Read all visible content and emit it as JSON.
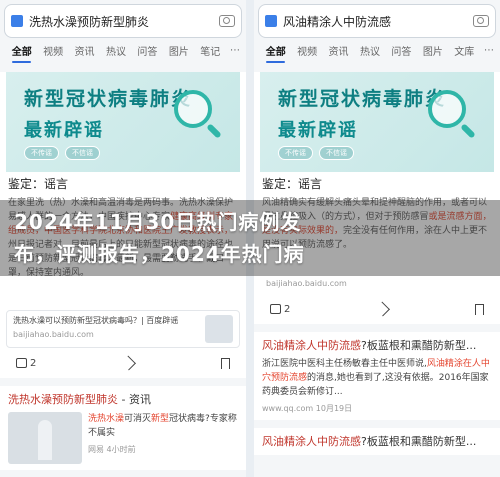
{
  "left": {
    "query": "洗热水澡预防新型肺炎",
    "tabs": [
      "全部",
      "视频",
      "资讯",
      "热议",
      "问答",
      "图片",
      "笔记"
    ],
    "banner_line1": "新型冠状病毒肺炎",
    "banner_line2": "最新辟谣",
    "banner_pill1": "不传谣",
    "banner_pill2": "不信谣",
    "verdict": "鉴定：谣言",
    "snippet_a": "在家里洗（热）水澡和高温消毒是两码事。洗热水澡保护易感人群的一个方法，中国疾控中心专家",
    "snippet_b": "健康高级别专家组成员，中国医学科学院北京协和医院王广发教授表示，",
    "snippet_c": "州日报记者对，目前最后上的只能新型冠状病毒的途径也是日前预防新型冠状病毒，最新，最需要",
    "snippet_d": "勤洗手、戴口罩，保持室内通风。",
    "source_title": "洗热水澡可以预防新型冠状病毒吗？| 百度辟谣",
    "source_site": "baijiahao.baidu.com",
    "likes": "2",
    "result_title_a": "洗热水澡预防新型肺炎",
    "result_title_b": " - 资讯",
    "result_text_a": "洗热水澡",
    "result_text_b": "可消灭",
    "result_text_c": "新型",
    "result_text_d": "冠状病毒?专家称不属实",
    "result_meta": "网易   4小时前"
  },
  "right": {
    "query": "风油精涂人中防流感",
    "tabs": [
      "全部",
      "视频",
      "资讯",
      "热议",
      "问答",
      "图片",
      "文库"
    ],
    "banner_line1": "新型冠状病毒肺炎",
    "banner_line2": "最新辟谣",
    "banner_pill1": "不传谣",
    "banner_pill2": "不信谣",
    "verdict": "鉴定：谣言",
    "snippet_a": "风油精确实有缓解头痛头晕和提神醒脑的作用，或者可以通过鼻腔吸入（的方式），但对于预防感冒",
    "snippet_b": "或是流感方面，是没有实际效果的，",
    "snippet_c": "完全没有任何作用，涂在人中上更不用说可以预防流感了。",
    "snippet_d": "",
    "source_title": "",
    "source_site": "baijiahao.baidu.com",
    "likes": "2",
    "result_title_a": "风油精涂人中防流感",
    "result_title_b": "?板蓝根和熏醋防新型...",
    "result_text_a": "浙江医院中医科主任杨敏春主任中医师说,",
    "result_text_b": "风油精涂在人中穴预防流感",
    "result_text_c": "的消息,她也看到了,这没有依据。2016年国家药典委员会新修订...",
    "result_meta": "www.qq.com   10月19日",
    "result2_title_a": "风油精涂人中防流感",
    "result2_title_b": "?板蓝根和熏醋防新型..."
  },
  "overlay": {
    "line1": "2024年11月30日热门病例发",
    "line2": "布，评测报告，2024年热门病"
  }
}
